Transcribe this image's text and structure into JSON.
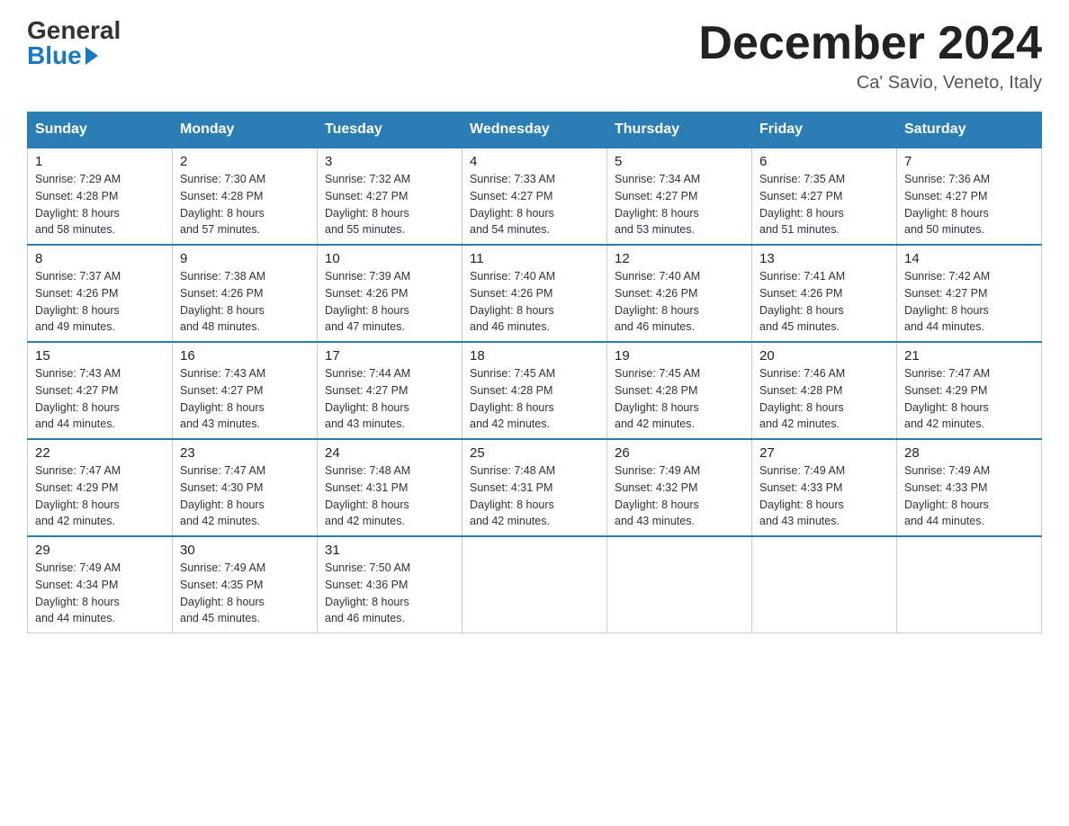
{
  "header": {
    "logo_general": "General",
    "logo_blue": "Blue",
    "month_title": "December 2024",
    "location": "Ca' Savio, Veneto, Italy"
  },
  "weekdays": [
    "Sunday",
    "Monday",
    "Tuesday",
    "Wednesday",
    "Thursday",
    "Friday",
    "Saturday"
  ],
  "weeks": [
    [
      {
        "day": "1",
        "sunrise": "Sunrise: 7:29 AM",
        "sunset": "Sunset: 4:28 PM",
        "daylight": "Daylight: 8 hours",
        "daylight2": "and 58 minutes."
      },
      {
        "day": "2",
        "sunrise": "Sunrise: 7:30 AM",
        "sunset": "Sunset: 4:28 PM",
        "daylight": "Daylight: 8 hours",
        "daylight2": "and 57 minutes."
      },
      {
        "day": "3",
        "sunrise": "Sunrise: 7:32 AM",
        "sunset": "Sunset: 4:27 PM",
        "daylight": "Daylight: 8 hours",
        "daylight2": "and 55 minutes."
      },
      {
        "day": "4",
        "sunrise": "Sunrise: 7:33 AM",
        "sunset": "Sunset: 4:27 PM",
        "daylight": "Daylight: 8 hours",
        "daylight2": "and 54 minutes."
      },
      {
        "day": "5",
        "sunrise": "Sunrise: 7:34 AM",
        "sunset": "Sunset: 4:27 PM",
        "daylight": "Daylight: 8 hours",
        "daylight2": "and 53 minutes."
      },
      {
        "day": "6",
        "sunrise": "Sunrise: 7:35 AM",
        "sunset": "Sunset: 4:27 PM",
        "daylight": "Daylight: 8 hours",
        "daylight2": "and 51 minutes."
      },
      {
        "day": "7",
        "sunrise": "Sunrise: 7:36 AM",
        "sunset": "Sunset: 4:27 PM",
        "daylight": "Daylight: 8 hours",
        "daylight2": "and 50 minutes."
      }
    ],
    [
      {
        "day": "8",
        "sunrise": "Sunrise: 7:37 AM",
        "sunset": "Sunset: 4:26 PM",
        "daylight": "Daylight: 8 hours",
        "daylight2": "and 49 minutes."
      },
      {
        "day": "9",
        "sunrise": "Sunrise: 7:38 AM",
        "sunset": "Sunset: 4:26 PM",
        "daylight": "Daylight: 8 hours",
        "daylight2": "and 48 minutes."
      },
      {
        "day": "10",
        "sunrise": "Sunrise: 7:39 AM",
        "sunset": "Sunset: 4:26 PM",
        "daylight": "Daylight: 8 hours",
        "daylight2": "and 47 minutes."
      },
      {
        "day": "11",
        "sunrise": "Sunrise: 7:40 AM",
        "sunset": "Sunset: 4:26 PM",
        "daylight": "Daylight: 8 hours",
        "daylight2": "and 46 minutes."
      },
      {
        "day": "12",
        "sunrise": "Sunrise: 7:40 AM",
        "sunset": "Sunset: 4:26 PM",
        "daylight": "Daylight: 8 hours",
        "daylight2": "and 46 minutes."
      },
      {
        "day": "13",
        "sunrise": "Sunrise: 7:41 AM",
        "sunset": "Sunset: 4:26 PM",
        "daylight": "Daylight: 8 hours",
        "daylight2": "and 45 minutes."
      },
      {
        "day": "14",
        "sunrise": "Sunrise: 7:42 AM",
        "sunset": "Sunset: 4:27 PM",
        "daylight": "Daylight: 8 hours",
        "daylight2": "and 44 minutes."
      }
    ],
    [
      {
        "day": "15",
        "sunrise": "Sunrise: 7:43 AM",
        "sunset": "Sunset: 4:27 PM",
        "daylight": "Daylight: 8 hours",
        "daylight2": "and 44 minutes."
      },
      {
        "day": "16",
        "sunrise": "Sunrise: 7:43 AM",
        "sunset": "Sunset: 4:27 PM",
        "daylight": "Daylight: 8 hours",
        "daylight2": "and 43 minutes."
      },
      {
        "day": "17",
        "sunrise": "Sunrise: 7:44 AM",
        "sunset": "Sunset: 4:27 PM",
        "daylight": "Daylight: 8 hours",
        "daylight2": "and 43 minutes."
      },
      {
        "day": "18",
        "sunrise": "Sunrise: 7:45 AM",
        "sunset": "Sunset: 4:28 PM",
        "daylight": "Daylight: 8 hours",
        "daylight2": "and 42 minutes."
      },
      {
        "day": "19",
        "sunrise": "Sunrise: 7:45 AM",
        "sunset": "Sunset: 4:28 PM",
        "daylight": "Daylight: 8 hours",
        "daylight2": "and 42 minutes."
      },
      {
        "day": "20",
        "sunrise": "Sunrise: 7:46 AM",
        "sunset": "Sunset: 4:28 PM",
        "daylight": "Daylight: 8 hours",
        "daylight2": "and 42 minutes."
      },
      {
        "day": "21",
        "sunrise": "Sunrise: 7:47 AM",
        "sunset": "Sunset: 4:29 PM",
        "daylight": "Daylight: 8 hours",
        "daylight2": "and 42 minutes."
      }
    ],
    [
      {
        "day": "22",
        "sunrise": "Sunrise: 7:47 AM",
        "sunset": "Sunset: 4:29 PM",
        "daylight": "Daylight: 8 hours",
        "daylight2": "and 42 minutes."
      },
      {
        "day": "23",
        "sunrise": "Sunrise: 7:47 AM",
        "sunset": "Sunset: 4:30 PM",
        "daylight": "Daylight: 8 hours",
        "daylight2": "and 42 minutes."
      },
      {
        "day": "24",
        "sunrise": "Sunrise: 7:48 AM",
        "sunset": "Sunset: 4:31 PM",
        "daylight": "Daylight: 8 hours",
        "daylight2": "and 42 minutes."
      },
      {
        "day": "25",
        "sunrise": "Sunrise: 7:48 AM",
        "sunset": "Sunset: 4:31 PM",
        "daylight": "Daylight: 8 hours",
        "daylight2": "and 42 minutes."
      },
      {
        "day": "26",
        "sunrise": "Sunrise: 7:49 AM",
        "sunset": "Sunset: 4:32 PM",
        "daylight": "Daylight: 8 hours",
        "daylight2": "and 43 minutes."
      },
      {
        "day": "27",
        "sunrise": "Sunrise: 7:49 AM",
        "sunset": "Sunset: 4:33 PM",
        "daylight": "Daylight: 8 hours",
        "daylight2": "and 43 minutes."
      },
      {
        "day": "28",
        "sunrise": "Sunrise: 7:49 AM",
        "sunset": "Sunset: 4:33 PM",
        "daylight": "Daylight: 8 hours",
        "daylight2": "and 44 minutes."
      }
    ],
    [
      {
        "day": "29",
        "sunrise": "Sunrise: 7:49 AM",
        "sunset": "Sunset: 4:34 PM",
        "daylight": "Daylight: 8 hours",
        "daylight2": "and 44 minutes."
      },
      {
        "day": "30",
        "sunrise": "Sunrise: 7:49 AM",
        "sunset": "Sunset: 4:35 PM",
        "daylight": "Daylight: 8 hours",
        "daylight2": "and 45 minutes."
      },
      {
        "day": "31",
        "sunrise": "Sunrise: 7:50 AM",
        "sunset": "Sunset: 4:36 PM",
        "daylight": "Daylight: 8 hours",
        "daylight2": "and 46 minutes."
      },
      null,
      null,
      null,
      null
    ]
  ]
}
